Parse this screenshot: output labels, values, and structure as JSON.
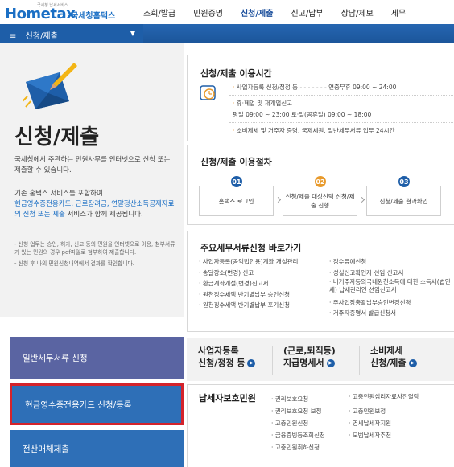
{
  "header": {
    "logo_small": "국세청 납세서비스",
    "logo_main": "Hometax",
    "logo_sub": "국세청홈택스",
    "nav": [
      "조회/발급",
      "민원증명",
      "신청/제출",
      "신고/납부",
      "상담/제보",
      "세무"
    ]
  },
  "menubar": {
    "current": "신청/제출"
  },
  "left": {
    "title": "신청/제출",
    "desc1": "국세청에서 주관하는 민원사무를 인터넷으로 신청 또는 제출할 수 있습니다.",
    "desc2a": "기존 홈택스 서비스를 포함하여",
    "desc2_hl": "현금영수증전용카드, 근로장려금, 연말정산소득공제자료의 신청 또는 제출",
    "desc2b": "서비스가 함께 제공됩니다.",
    "note1": "- 신청 업무는 승인, 허가, 신고 등의 민원을 인터넷으로 이용, 첨부서류가 있는 민원의 경우 pdf파일로 첨부하여 제출합니다.",
    "note2": "- 신청 후 나의 민원신청내역에서 결과를 확인합니다.",
    "buttons": [
      "일반세무서류 신청",
      "현금영수증전용카드 신청/등록",
      "전산매체제출"
    ]
  },
  "time_box": {
    "title": "신청/제출 이용시간",
    "line1_label": "사업자등록 신청/정정 등",
    "line1_value": "연중무휴 09:00 ~ 24:00",
    "line2_label": "휴·폐업 및 재개업신고",
    "line2_value": "평일 09:00 ~ 23:00 토·일(공휴일) 09:00 ~ 18:00",
    "line3": "소비제세 및 거주자 증명, 국제세원, 일반세무서류 업무 24시간"
  },
  "proc_box": {
    "title": "신청/제출 이용절차",
    "steps": [
      {
        "num": "01",
        "label": "홈택스 로그인"
      },
      {
        "num": "02",
        "label": "신청/제출 대상선택 신청/제출 진행"
      },
      {
        "num": "03",
        "label": "신청/제출 결과확인"
      }
    ],
    "colors": {
      "step1": "#1e5ea8",
      "step2": "#e89a2c",
      "step3": "#1e5ea8"
    }
  },
  "quick_box": {
    "title": "주요세무서류신청 바로가기",
    "col1": [
      "사업자등록(공익법인용)계좌 개설관리",
      "송달장소(변경) 신고",
      "환급계좌개설(변경)신고서",
      "원천징수세액 반기별납부 승인신청",
      "원천징수세액 반기별납부 포기신청"
    ],
    "col2": [
      "징수유예신청",
      "성실신고확인자 선임 신고서",
      "비거주자등의국내원천소득에 대한 소득세(법인세) 납세관리인 선임신고서",
      "주사업장총괄납부승인변경신청",
      "거주자증명서 발급신청서"
    ]
  },
  "tiles": [
    {
      "line1": "사업자등록",
      "line2": "신청/정정 등"
    },
    {
      "line1": "(근로,퇴직등)",
      "line2": "지급명세서"
    },
    {
      "line1": "소비제세",
      "line2": "신청/제출"
    }
  ],
  "protection": {
    "title": "납세자보호민원",
    "col1": [
      "권리보호요청",
      "권리보호요청 보정",
      "고충민원신청",
      "금융증빙등조회신청",
      "고충민원취하신청"
    ],
    "col2": [
      "고충민원심리자료사전열람",
      "고충민원보정",
      "영세납세자지원",
      "모범납세자추천"
    ]
  }
}
